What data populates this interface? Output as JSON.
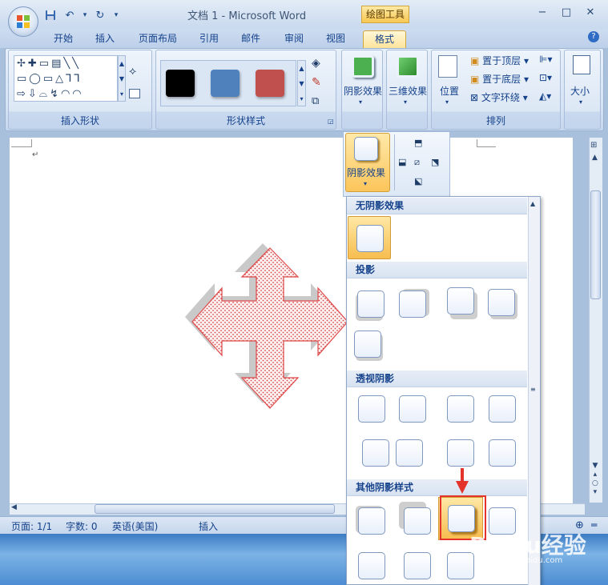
{
  "window": {
    "title": "文档 1 - Microsoft Word",
    "context_tool": "绘图工具",
    "controls": [
      "−",
      "□",
      "✕"
    ]
  },
  "tabs": [
    "开始",
    "插入",
    "页面布局",
    "引用",
    "邮件",
    "审阅",
    "视图",
    "格式"
  ],
  "ribbon": {
    "groups": {
      "insert_shapes": "插入形状",
      "shape_styles": "形状样式",
      "arrange": "排列"
    },
    "shadow_effects_label": "阴影效果",
    "three_d_label": "三维效果",
    "position_label": "位置",
    "bring_front": "置于顶层",
    "send_back": "置于底层",
    "text_wrap": "文字环绕",
    "size_label": "大小",
    "style_colors": [
      "#000000",
      "#4f81bd",
      "#c0504d"
    ]
  },
  "shadow_popup": {
    "effect_label": "阴影效果"
  },
  "gallery": {
    "sections": [
      "无阴影效果",
      "投影",
      "透视阴影",
      "其他阴影样式"
    ]
  },
  "statusbar": {
    "page": "页面: 1/1",
    "words": "字数: 0",
    "language": "英语(美国)",
    "mode": "插入"
  },
  "watermark": {
    "brand": "Baidu经验",
    "url": "jingyan.baidu.com"
  },
  "colors": {
    "accent": "#fbc55b",
    "highlight": "#e3332b",
    "shape_fill": "#fbe1e1"
  }
}
